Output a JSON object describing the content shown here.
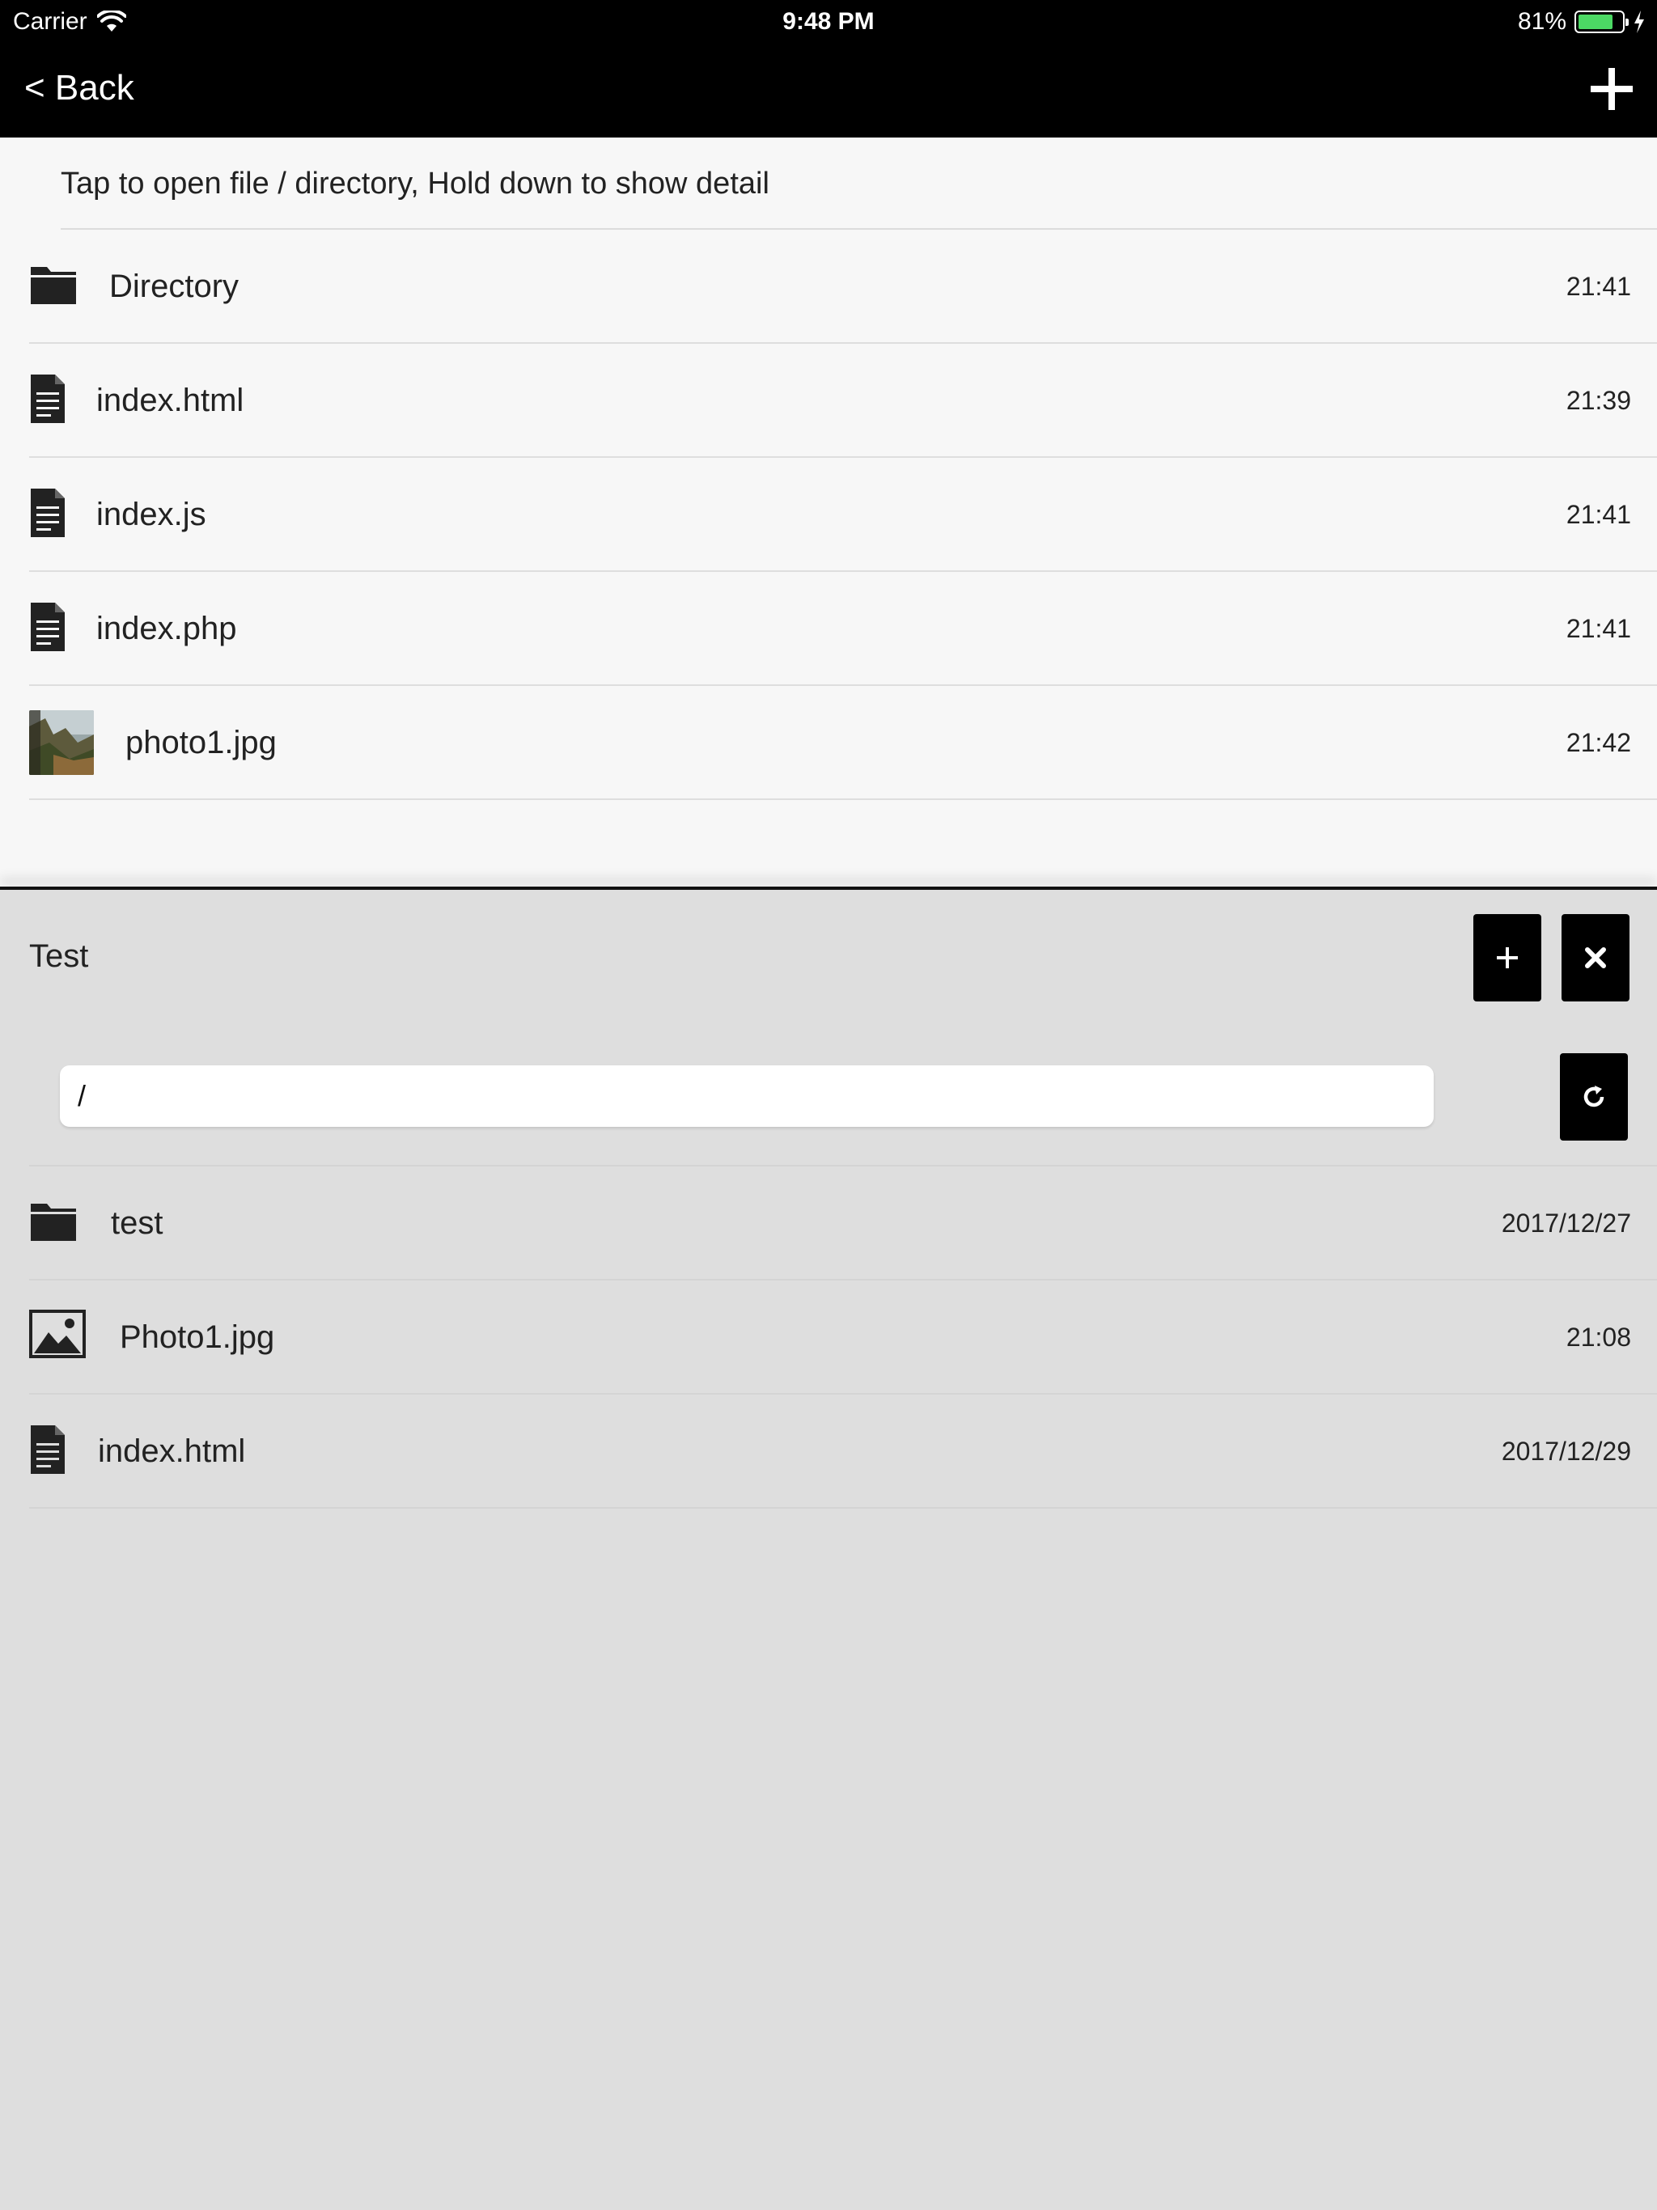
{
  "status_bar": {
    "carrier": "Carrier",
    "time": "9:48 PM",
    "battery_percent": "81%",
    "battery_level": 0.81,
    "battery_color": "#4cd964"
  },
  "nav": {
    "back_label": "< Back",
    "add_icon": "plus-icon"
  },
  "top_panel": {
    "hint": "Tap to open file / directory, Hold down to show detail",
    "items": [
      {
        "name": "Directory",
        "time": "21:41",
        "icon": "folder-icon"
      },
      {
        "name": "index.html",
        "time": "21:39",
        "icon": "file-icon"
      },
      {
        "name": "index.js",
        "time": "21:41",
        "icon": "file-icon"
      },
      {
        "name": "index.php",
        "time": "21:41",
        "icon": "file-icon"
      },
      {
        "name": "photo1.jpg",
        "time": "21:42",
        "icon": "photo-thumbnail"
      }
    ]
  },
  "bottom_panel": {
    "title": "Test",
    "add_icon": "plus-icon",
    "close_icon": "close-icon",
    "path_value": "/",
    "refresh_icon": "refresh-icon",
    "items": [
      {
        "name": "test",
        "time": "2017/12/27",
        "icon": "folder-icon"
      },
      {
        "name": "Photo1.jpg",
        "time": "21:08",
        "icon": "image-icon"
      },
      {
        "name": "index.html",
        "time": "2017/12/29",
        "icon": "file-icon"
      }
    ]
  }
}
